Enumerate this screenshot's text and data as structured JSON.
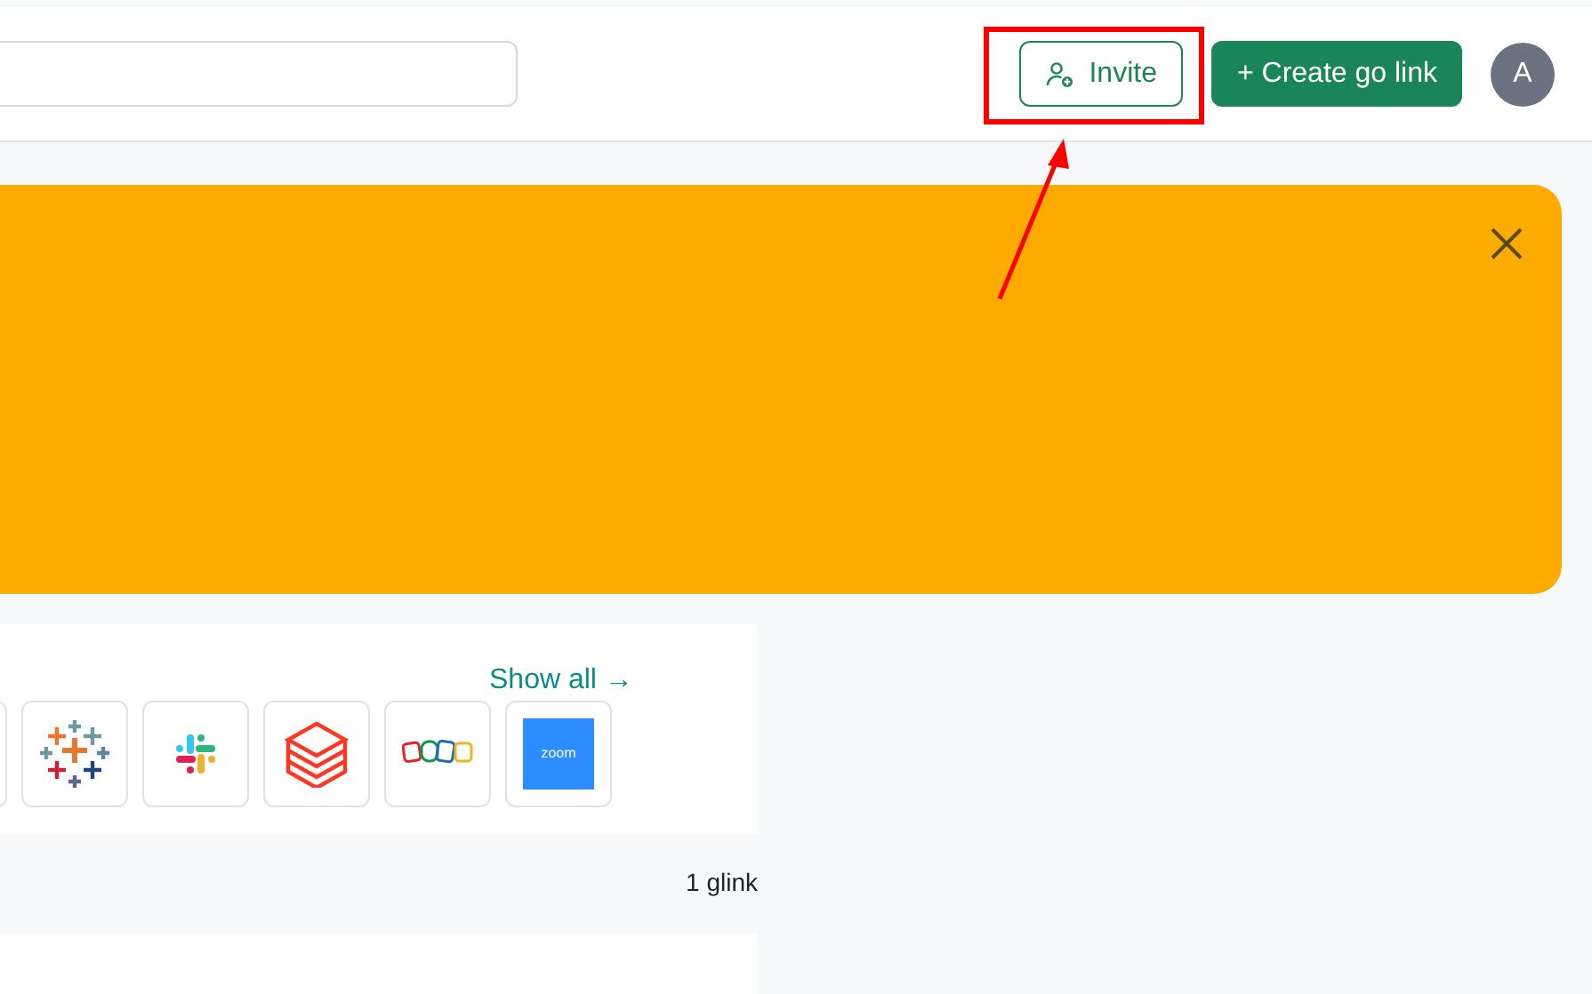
{
  "header": {
    "buttons": [
      {
        "kind": "outline",
        "label": "Invite"
      },
      {
        "kind": "primary",
        "label": "+ Create go link"
      }
    ],
    "avatar": "A"
  },
  "apps": {
    "link": "Show all →",
    "tiles": [
      {
        "kind": "partial"
      },
      {
        "kind": "tableau"
      },
      {
        "kind": "slack"
      },
      {
        "kind": "databricks"
      },
      {
        "kind": "zoho"
      },
      {
        "kind": "zoom",
        "text": "zoom"
      }
    ]
  },
  "count": "1 glink"
}
